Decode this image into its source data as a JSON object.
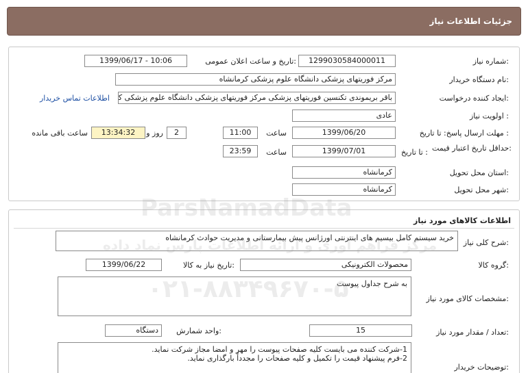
{
  "header": {
    "title": "جزئیات اطلاعات نیاز"
  },
  "need_info": {
    "need_number_label": "شماره نیاز:",
    "need_number": "1299030584000011",
    "announce_label": "تاریخ و ساعت اعلان عمومی:",
    "announce_value": "1399/06/17 - 10:06",
    "buyer_org_label": "نام دستگاه خریدار:",
    "buyer_org": "مرکز فوریتهای پزشکی دانشگاه علوم پزشکی کرمانشاه",
    "requester_label": "ایجاد کننده درخواست:",
    "requester": "باقر بریموندی تکنسین فوریتهای پزشکی مرکز فوریتهای پزشکی دانشگاه علوم پزشکی کرمانشاه",
    "contact_link": "اطلاعات تماس خریدار",
    "priority_label": "اولویت نیاز :",
    "priority": "عادی",
    "response_deadline_label": "مهلت ارسال پاسخ:  تا تاریخ :",
    "response_date": "1399/06/20",
    "time_label": "ساعت",
    "response_time": "11:00",
    "days_remaining": "2",
    "days_label": "روز و",
    "time_remaining": "13:34:32",
    "remaining_label": "ساعت باقی مانده",
    "price_validity_label": "حداقل تاریخ اعتبار قیمت:",
    "price_until_label": "تا تاریخ :",
    "price_date": "1399/07/01",
    "price_time_label": "ساعت",
    "price_time": "23:59",
    "province_label": "استان محل تحویل:",
    "province": "کرمانشاه",
    "city_label": "شهر محل تحویل:",
    "city": "کرمانشاه"
  },
  "goods": {
    "section_title": "اطلاعات کالاهای مورد نیاز",
    "summary_label": "شرح کلی نیاز:",
    "summary": "خرید سیستم کامل بیسیم های اینترنتی اورژانس پیش بیمارستانی و مدیریت حوادث کرمانشاه",
    "group_label": "گروه کالا:",
    "group": "محصولات الکترونیکی",
    "need_date_label": "تاریخ نیاز به کالا:",
    "need_date": "1399/06/22",
    "specs_label": "مشخصات کالای مورد نیاز:",
    "specs": "به شرح جداول پیوست",
    "qty_label": "تعداد / مقدار مورد نیاز:",
    "qty": "15",
    "unit_label": "واحد شمارش:",
    "unit": "دستگاه",
    "buyer_desc_label": "توضیحات خریدار:",
    "buyer_desc_line1": "1-شرکت کننده می بایست کلیه صفحات پیوست را مهر و امضا مجاز شرکت نماید.",
    "buyer_desc_line2": "2-فرم پیشنهاد قیمت را تکمیل و کلیه صفحات را مجدداً بارگذاری نماید."
  },
  "watermark": {
    "brand": "ParsNamadData",
    "phone": "۰۲۱-۸۸۳۴۹۶۷۰-۵",
    "tagline": "مرکز فراهم آوری و ارائه اطلاعات پارس نماد داده"
  }
}
